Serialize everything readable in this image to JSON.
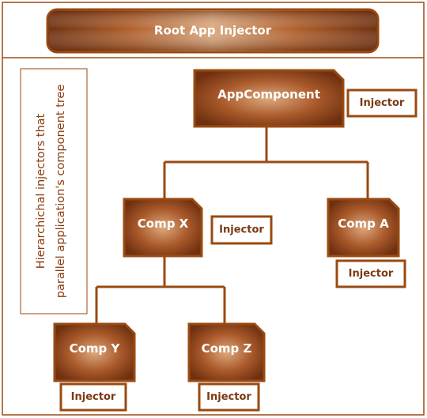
{
  "root": {
    "label": "Root App Injector"
  },
  "side_note": {
    "line1": "Hierarchichal injectors that",
    "line2": "parallel application's component tree"
  },
  "nodes": {
    "app": {
      "label": "AppComponent",
      "injector": "Injector"
    },
    "compx": {
      "label": "Comp X",
      "injector": "Injector"
    },
    "compa": {
      "label": "Comp A",
      "injector": "Injector"
    },
    "compy": {
      "label": "Comp Y",
      "injector": "Injector"
    },
    "compz": {
      "label": "Comp Z",
      "injector": "Injector"
    }
  },
  "colors": {
    "border": "#9a4a10",
    "node_light": "#dca97e",
    "node_dark": "#6e3010"
  }
}
